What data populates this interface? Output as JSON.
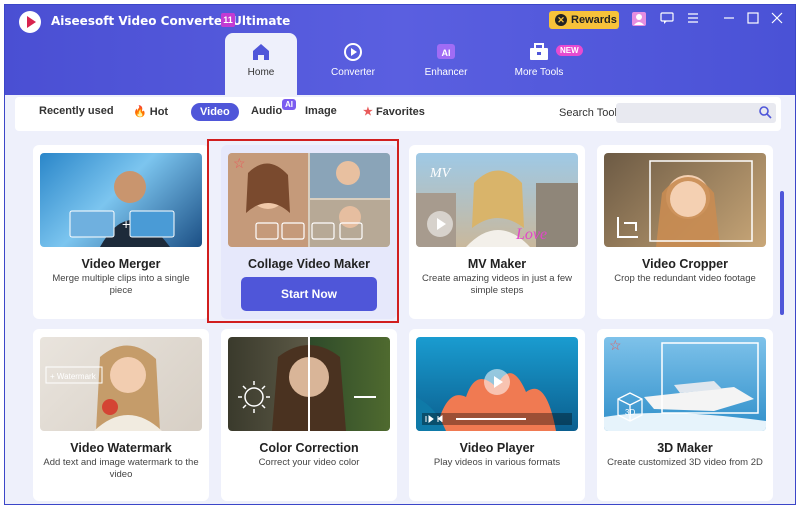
{
  "app": {
    "title": "Aiseesoft Video Converter Ultimate",
    "version_badge": "11",
    "rewards_label": "Rewards"
  },
  "nav": {
    "tabs": [
      {
        "label": "Home",
        "icon": "home-icon",
        "active": true
      },
      {
        "label": "Converter",
        "icon": "converter-icon",
        "active": false
      },
      {
        "label": "Enhancer",
        "icon": "ai-enhancer-icon",
        "active": false
      },
      {
        "label": "More Tools",
        "icon": "toolbox-icon",
        "active": false
      }
    ],
    "new_badge": "NEW"
  },
  "filters": {
    "tabs": [
      {
        "label": "Recently used",
        "active": false
      },
      {
        "label": "Hot",
        "icon": "flame-icon",
        "active": false
      },
      {
        "label": "Video",
        "active": true
      },
      {
        "label": "Audio",
        "active": false
      },
      {
        "label": "Image",
        "active": false
      },
      {
        "label": "Favorites",
        "icon": "star-icon",
        "active": false
      }
    ],
    "ai_badge": "AI",
    "search_label": "Search Tool:",
    "search_placeholder": ""
  },
  "tools": [
    {
      "title": "Video Merger",
      "desc": "Merge multiple clips into a single piece"
    },
    {
      "title": "Collage Video Maker",
      "button": "Start Now"
    },
    {
      "title": "MV Maker",
      "desc": "Create amazing videos in just a few simple steps"
    },
    {
      "title": "Video Cropper",
      "desc": "Crop the redundant video footage"
    },
    {
      "title": "Video Watermark",
      "desc": "Add text and image watermark to the video",
      "thumb_label": "+ Watermark"
    },
    {
      "title": "Color Correction",
      "desc": "Correct your video color"
    },
    {
      "title": "Video Player",
      "desc": "Play videos in various formats"
    },
    {
      "title": "3D Maker",
      "desc": "Create customized 3D video from 2D",
      "thumb_label": "3D"
    }
  ],
  "colors": {
    "accent": "#4f56d9",
    "topbar": "#4a4fd3",
    "highlight_border": "#d11e1e",
    "rewards": "#f7c23a"
  }
}
